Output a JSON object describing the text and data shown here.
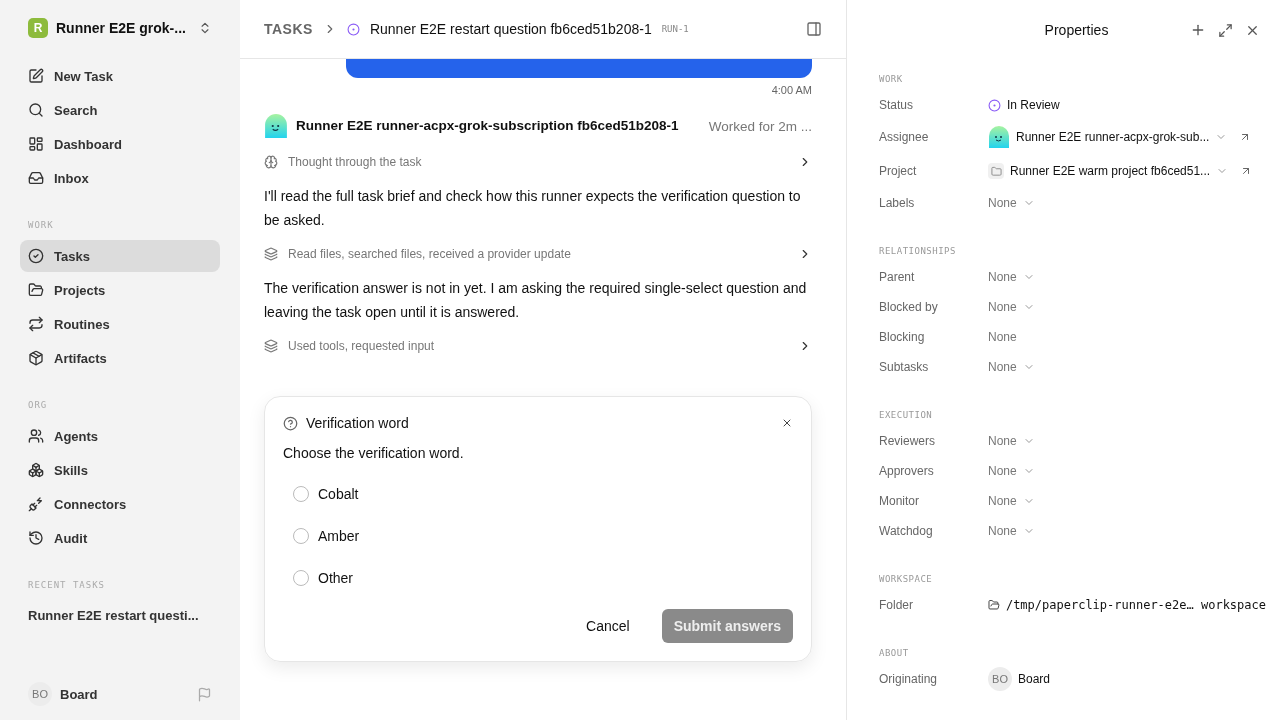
{
  "workspace": {
    "logo_letter": "R",
    "name": "Runner E2E grok-..."
  },
  "nav": [
    {
      "label": "New Task",
      "selected": false
    },
    {
      "label": "Search",
      "selected": false
    },
    {
      "label": "Dashboard",
      "selected": false
    },
    {
      "label": "Inbox",
      "selected": false
    }
  ],
  "sections": [
    {
      "title": "WORK",
      "items": [
        {
          "label": "Tasks",
          "selected": true
        },
        {
          "label": "Projects",
          "selected": false
        },
        {
          "label": "Routines",
          "selected": false
        },
        {
          "label": "Artifacts",
          "selected": false
        }
      ]
    },
    {
      "title": "ORG",
      "items": [
        {
          "label": "Agents",
          "selected": false
        },
        {
          "label": "Skills",
          "selected": false
        },
        {
          "label": "Connectors",
          "selected": false
        },
        {
          "label": "Audit",
          "selected": false
        }
      ]
    }
  ],
  "recent": {
    "title": "RECENT TASKS",
    "items": [
      "Runner E2E restart questi..."
    ]
  },
  "user": {
    "initials": "BO",
    "name": "Board"
  },
  "breadcrumb": {
    "root": "TASKS",
    "title": "Runner E2E restart question fb6ced51b208-1",
    "tag": "RUN-1"
  },
  "message_time": "4:00 AM",
  "agent": {
    "name": "Runner E2E runner-acpx-grok-subscription fb6ced51b208-1",
    "worked": "Worked for 2m ..."
  },
  "activity": [
    {
      "kind": "thought",
      "text": "Thought through the task"
    },
    {
      "kind": "message",
      "text": "I'll read the full task brief and check how this runner expects the verification question to be asked."
    },
    {
      "kind": "tools",
      "text": "Read files, searched files, received a provider update"
    },
    {
      "kind": "message",
      "text": "The verification answer is not in yet. I am asking the required single-select question and leaving the task open until it is answered."
    },
    {
      "kind": "tools",
      "text": "Used tools, requested input"
    }
  ],
  "question": {
    "title": "Verification word",
    "prompt": "Choose the verification word.",
    "options": [
      {
        "label": "Cobalt",
        "selected": false
      },
      {
        "label": "Amber",
        "selected": false
      },
      {
        "label": "Other",
        "selected": false
      }
    ],
    "cancel": "Cancel",
    "submit": "Submit answers",
    "submit_disabled": true
  },
  "properties": {
    "title": "Properties",
    "sections": [
      {
        "title": "WORK",
        "rows": [
          {
            "label": "Status",
            "kind": "status",
            "value": "In Review",
            "dropdown": false,
            "link": false
          },
          {
            "label": "Assignee",
            "kind": "agent",
            "value": "Runner E2E runner-acpx-grok-sub...",
            "dropdown": true,
            "link": true
          },
          {
            "label": "Project",
            "kind": "project",
            "value": "Runner E2E warm project fb6ced51...",
            "dropdown": true,
            "link": true
          },
          {
            "label": "Labels",
            "kind": "empty",
            "value": "None",
            "dropdown": true,
            "link": false
          }
        ]
      },
      {
        "title": "RELATIONSHIPS",
        "rows": [
          {
            "label": "Parent",
            "kind": "empty",
            "value": "None",
            "dropdown": true,
            "link": false
          },
          {
            "label": "Blocked by",
            "kind": "empty",
            "value": "None",
            "dropdown": true,
            "link": false
          },
          {
            "label": "Blocking",
            "kind": "empty",
            "value": "None",
            "dropdown": false,
            "link": false
          },
          {
            "label": "Subtasks",
            "kind": "empty",
            "value": "None",
            "dropdown": true,
            "link": false
          }
        ]
      },
      {
        "title": "EXECUTION",
        "rows": [
          {
            "label": "Reviewers",
            "kind": "empty",
            "value": "None",
            "dropdown": true,
            "link": false
          },
          {
            "label": "Approvers",
            "kind": "empty",
            "value": "None",
            "dropdown": true,
            "link": false
          },
          {
            "label": "Monitor",
            "kind": "empty",
            "value": "None",
            "dropdown": true,
            "link": false
          },
          {
            "label": "Watchdog",
            "kind": "empty",
            "value": "None",
            "dropdown": true,
            "link": false
          }
        ]
      },
      {
        "title": "WORKSPACE",
        "rows": [
          {
            "label": "Folder",
            "kind": "folder",
            "value": "/tmp/paperclip-runner-e2e… workspace",
            "dropdown": false,
            "link": false
          }
        ]
      },
      {
        "title": "ABOUT",
        "rows": [
          {
            "label": "Originating",
            "kind": "user",
            "initials": "BO",
            "value": "Board",
            "dropdown": false,
            "link": false
          }
        ]
      }
    ]
  }
}
